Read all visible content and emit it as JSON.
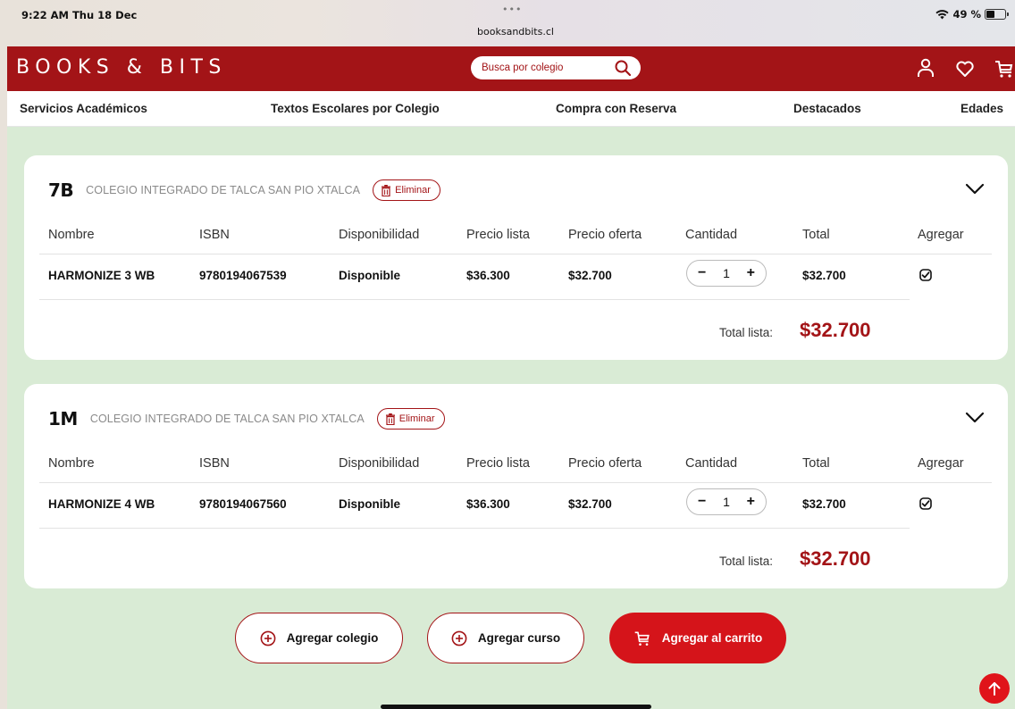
{
  "status_bar": {
    "time": "9:22 AM  Thu 18 Dec",
    "dots": "•••",
    "url": "booksandbits.cl",
    "battery": "49 %"
  },
  "header": {
    "logo": "BOOKS & BITS",
    "search_placeholder": "Busca por colegio",
    "brand_color": "#a31417"
  },
  "nav": {
    "items": [
      "Servicios Académicos",
      "Textos Escolares por Colegio",
      "Compra con Reserva",
      "Destacados",
      "Edades"
    ]
  },
  "table_headers": [
    "Nombre",
    "ISBN",
    "Disponibilidad",
    "Precio lista",
    "Precio oferta",
    "Cantidad",
    "Total",
    "Agregar"
  ],
  "cards": [
    {
      "course": "7B",
      "school": "COLEGIO INTEGRADO DE TALCA SAN PIO XTALCA",
      "remove_label": "Eliminar",
      "row": {
        "name": "HARMONIZE 3 WB",
        "isbn": "9780194067539",
        "availability": "Disponible",
        "list_price": "$36.300",
        "offer_price": "$32.700",
        "quantity": "1",
        "total": "$32.700",
        "add_checked": true
      },
      "total_label": "Total lista:",
      "total_value": "$32.700"
    },
    {
      "course": "1M",
      "school": "COLEGIO INTEGRADO DE TALCA SAN PIO XTALCA",
      "remove_label": "Eliminar",
      "row": {
        "name": "HARMONIZE 4 WB",
        "isbn": "9780194067560",
        "availability": "Disponible",
        "list_price": "$36.300",
        "offer_price": "$32.700",
        "quantity": "1",
        "total": "$32.700",
        "add_checked": true
      },
      "total_label": "Total lista:",
      "total_value": "$32.700"
    }
  ],
  "actions": {
    "add_school": "Agregar colegio",
    "add_course": "Agregar curso",
    "add_to_cart": "Agregar al carrito"
  },
  "icons": [
    "wifi-icon",
    "battery-icon",
    "search-icon",
    "user-icon",
    "heart-icon",
    "cart-icon",
    "trash-icon",
    "chevron-down-icon",
    "checkbox-checked-icon",
    "plus-circle-icon",
    "arrow-up-icon"
  ]
}
